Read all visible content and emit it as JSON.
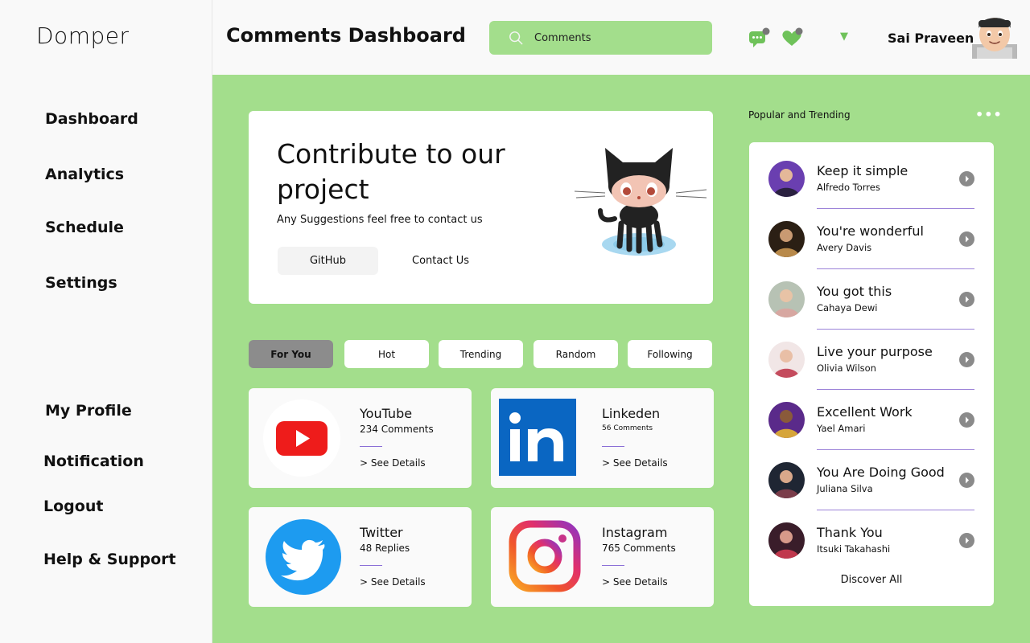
{
  "app": {
    "logo": "Domper"
  },
  "sidebar": {
    "top_items": [
      "Dashboard",
      "Analytics",
      "Schedule",
      "Settings"
    ],
    "bottom_items": [
      "My Profile",
      "Notification",
      "Logout",
      "Help & Support"
    ]
  },
  "header": {
    "title": "Comments Dashboard",
    "search_placeholder": "Comments",
    "user_name": "Sai Praveen"
  },
  "hero": {
    "title": "Contribute to our project",
    "subtitle": "Any Suggestions feel free to contact us",
    "github_label": "GitHub",
    "contact_label": "Contact Us"
  },
  "filters": [
    "For You",
    "Hot",
    "Trending",
    "Random",
    "Following"
  ],
  "active_filter": "For You",
  "platforms": [
    {
      "name": "YouTube",
      "count": "234 Comments",
      "link": "> See Details",
      "icon": "youtube-icon"
    },
    {
      "name": "Linkeden",
      "count": "56 Comments",
      "link": "> See Details",
      "icon": "linkedin-icon"
    },
    {
      "name": "Twitter",
      "count": "48 Replies",
      "link": "> See Details",
      "icon": "twitter-icon"
    },
    {
      "name": "Instagram",
      "count": "765 Comments",
      "link": "> See Details",
      "icon": "instagram-icon"
    }
  ],
  "trending": {
    "title": "Popular and Trending",
    "more": "•••",
    "items": [
      {
        "text": "Keep it simple",
        "name": "Alfredo Torres"
      },
      {
        "text": "You're wonderful",
        "name": "Avery Davis"
      },
      {
        "text": "You got this",
        "name": "Cahaya Dewi"
      },
      {
        "text": "Live your purpose",
        "name": "Olivia Wilson"
      },
      {
        "text": "Excellent Work",
        "name": "Yael Amari"
      },
      {
        "text": "You Are Doing Good",
        "name": "Juliana Silva"
      },
      {
        "text": "Thank You",
        "name": "Itsuki Takahashi"
      }
    ],
    "discover_label": "Discover All"
  },
  "colors": {
    "accent": "#a3de8c",
    "background": "#f9f9f9",
    "divider": "#9b82d8",
    "active_filter": "#8c8c8c"
  }
}
